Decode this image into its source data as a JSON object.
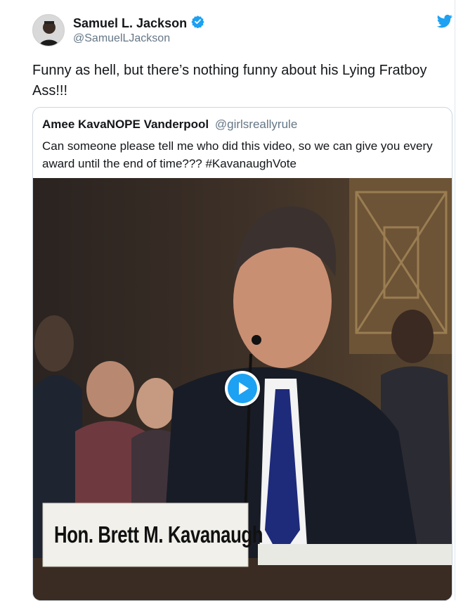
{
  "tweet": {
    "author_name": "Samuel L. Jackson",
    "author_handle": "@SamuelLJackson",
    "verified": true,
    "text": "Funny as hell, but there’s nothing funny about his Lying Fratboy Ass!!!"
  },
  "quoted_tweet": {
    "author_name": "Amee KavaNOPE Vanderpool",
    "author_handle": "@girlsreallyrule",
    "text": "Can someone please tell me who did this video, so we can give you every award until the end of time??? #KavanaughVote",
    "media": {
      "type": "video",
      "nameplate": "Hon. Brett M. Kavanaugh"
    }
  },
  "icons": {
    "verified": "verified-badge-icon",
    "bird": "twitter-bird-icon",
    "play": "play-icon"
  },
  "colors": {
    "brand": "#1da1f2",
    "text": "#14171a",
    "muted": "#657786",
    "border": "#ccd6dd"
  }
}
